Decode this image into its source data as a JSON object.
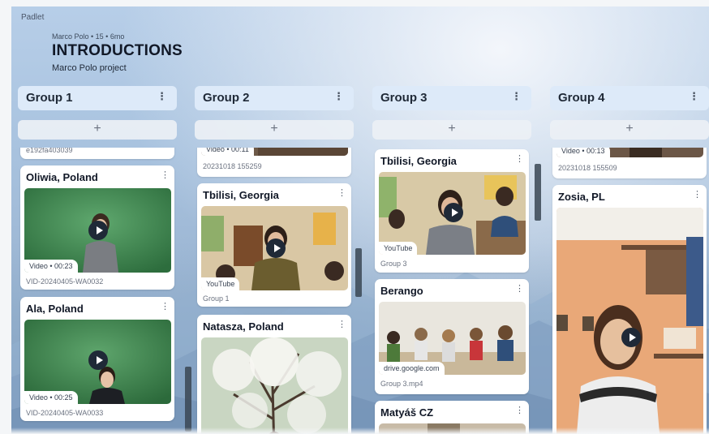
{
  "app": {
    "brand": "Padlet"
  },
  "board": {
    "meta": "Marco Polo • 15 • 6mo",
    "title": "INTRODUCTIONS",
    "subtitle": "Marco Polo project"
  },
  "add_symbol": "+",
  "kebab_symbol": "⋮",
  "columns": [
    {
      "title": "Group 1",
      "cards": [
        {
          "caption": "e192fa403039"
        },
        {
          "title": "Oliwia, Poland",
          "tag": "Video • 00:23",
          "caption": "VID-20240405-WA0032"
        },
        {
          "title": "Ala, Poland",
          "tag": "Video • 00:25",
          "caption": "VID-20240405-WA0033"
        }
      ]
    },
    {
      "title": "Group 2",
      "cards": [
        {
          "tag": "Video • 00:11",
          "caption": "20231018 155259"
        },
        {
          "title": "Tbilisi, Georgia",
          "tag": "YouTube",
          "caption": "Group 1"
        },
        {
          "title": "Natasza, Poland"
        }
      ]
    },
    {
      "title": "Group 3",
      "cards": [
        {
          "title": "Tbilisi, Georgia",
          "tag": "YouTube",
          "caption": "Group 3"
        },
        {
          "title": "Berango",
          "tag": "drive.google.com",
          "caption": "Group 3.mp4"
        },
        {
          "title": "Matyáš CZ"
        }
      ]
    },
    {
      "title": "Group 4",
      "cards": [
        {
          "tag": "Video • 00:13",
          "caption": "20231018 155509"
        },
        {
          "title": "Zosia, PL"
        }
      ]
    }
  ]
}
